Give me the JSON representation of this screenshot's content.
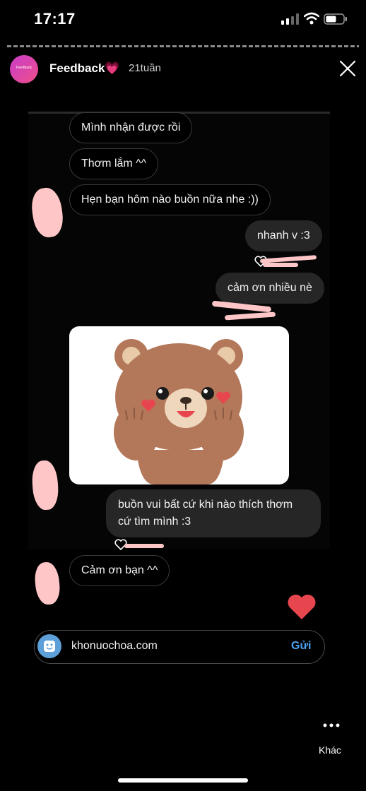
{
  "status_bar": {
    "time": "17:17",
    "battery_icon": "battery-icon",
    "wifi_icon": "wifi-icon"
  },
  "story": {
    "username": "Feedback💗",
    "avatar_text": "Feedback",
    "time_ago": "21tuần"
  },
  "messages": {
    "m1": "Mình nhận được rồi",
    "m2": "Thơm lắm ^^",
    "m3": "Hẹn bạn hôm nào buồn nữa nhe :))",
    "m4": "nhanh v :3",
    "m5": "cảm ơn nhiều nè",
    "m6": "buồn vui bất cứ khi nào thích thơm cứ tìm mình :3",
    "m7": "Cảm ơn bạn ^^"
  },
  "reply_bar": {
    "text": "khonuochoa.com",
    "send_label": "Gửi"
  },
  "more": {
    "label": "Khác"
  },
  "colors": {
    "background": "#000000",
    "outgoing_bubble": "#262626",
    "send_blue": "#4ea3f5",
    "heart_red": "#e8464f",
    "scribble_pink": "#ffc6c8",
    "bear_brown": "#b3785a"
  }
}
